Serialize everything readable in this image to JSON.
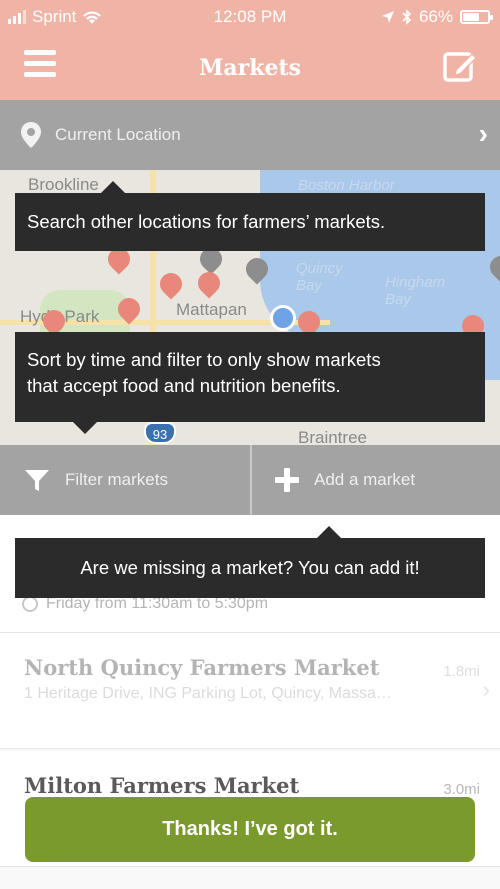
{
  "status_bar": {
    "carrier": "Sprint",
    "time": "12:08 PM",
    "battery": "66%",
    "battery_level": 0.66
  },
  "nav": {
    "title": "Markets",
    "menu_icon": "hamburger-menu-icon",
    "edit_icon": "compose-icon"
  },
  "location_bar": {
    "label": "Current Location",
    "icon": "location-pin-icon",
    "chevron": "›"
  },
  "map": {
    "labels": {
      "brookline": "Brookline",
      "boston_harbor": "Boston Harbor",
      "quincy_bay": "Quincy Bay",
      "hingham_bay": "Hingham Bay",
      "hyde_park": "Hyde Park",
      "mattapan": "Mattapan",
      "braintree": "Braintree",
      "route": "93"
    }
  },
  "filter_row": {
    "filter_label": "Filter markets",
    "add_label": "Add a market"
  },
  "tooltips": {
    "search": "Search other locations for farmers’ markets.",
    "sort_line1": "Sort by time and filter to only show markets",
    "sort_line2": "that accept food and nutrition benefits.",
    "missing": "Are we missing a market? You can add it!"
  },
  "list": {
    "first_item_time": "Friday from 11:30am to 5:30pm",
    "items": [
      {
        "name": "North Quincy Farmers Market",
        "distance": "1.8mi",
        "address": "1 Heritage Drive, ING Parking Lot, Quincy, Massa…"
      },
      {
        "name": "Milton Farmers Market",
        "distance": "3.0mi",
        "address": ""
      }
    ]
  },
  "cta": {
    "label": "Thanks! I’ve got it."
  },
  "colors": {
    "header": "#f0b4a6",
    "bar_gray": "#a3a3a3",
    "tooltip": "#2b2b2b",
    "cta_green": "#7a9a2e"
  }
}
